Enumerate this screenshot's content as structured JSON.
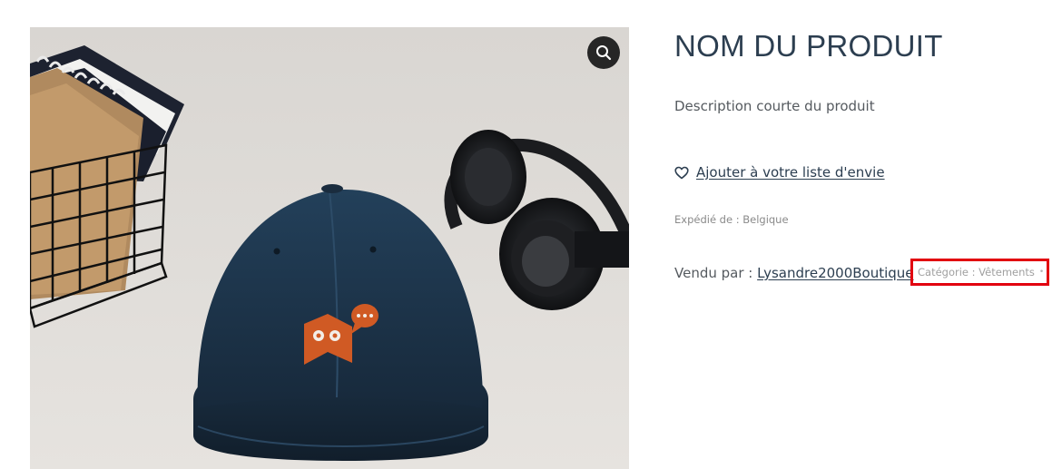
{
  "product": {
    "title": "NOM DU PRODUIT",
    "short_description": "Description courte du produit",
    "wishlist_label": "Ajouter à votre liste d'envie",
    "shipped_from": "Expédié de : Belgique",
    "sold_by_prefix": "Vendu par : ",
    "vendor_name": "Lysandre2000Boutique",
    "category": "Catégorie : Vêtements",
    "category_separator": "•"
  },
  "gallery": {
    "zoom_icon": "magnifier-icon",
    "image_subject": "navy snapback cap with orange logo"
  },
  "colors": {
    "title": "#2c3e50",
    "highlight_box": "#e2000f",
    "cap_navy": "#1c3247",
    "logo_orange": "#d05a24"
  }
}
